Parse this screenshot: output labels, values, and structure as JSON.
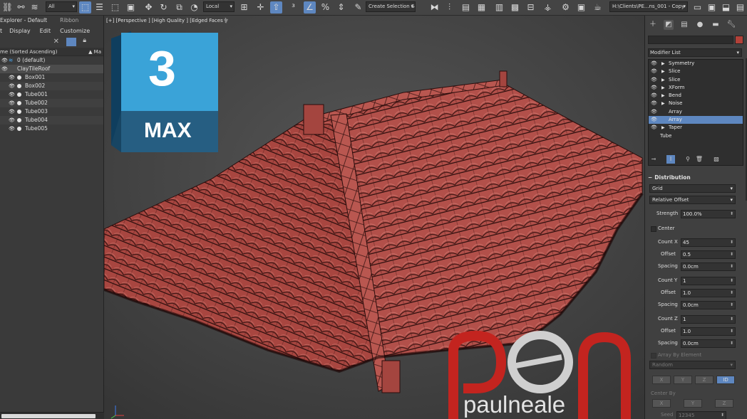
{
  "toolbar": {
    "selection_filter": "All",
    "reference_coord": "Local",
    "named_selection": "Create Selection Se",
    "project_path": "H:\\Clients\\PE...ns_001 - Copy",
    "icons": [
      "link-icon",
      "unlink-icon",
      "bind-spacewarp-icon",
      "select-object-icon",
      "select-by-name-icon",
      "select-region-icon",
      "window-crossing-icon",
      "move-icon",
      "rotate-icon",
      "scale-icon",
      "select-manipulate-icon",
      "pivot-center-icon",
      "select-and-link-icon",
      "snaps-icon",
      "angle-snap-icon",
      "percent-snap-icon",
      "spinner-snap-icon",
      "mirror-icon",
      "align-icon",
      "layer-explorer-icon",
      "ribbon-toggle-icon",
      "curve-editor-icon",
      "schematic-view-icon",
      "material-editor-icon",
      "render-setup-icon",
      "render-frame-icon",
      "render-icon"
    ]
  },
  "scene_explorer": {
    "title": "Explorer - Default",
    "ribbon_tab": "Ribbon",
    "menu": [
      "Display",
      "Edit",
      "Customize"
    ],
    "column_header": "me (Sorted Ascending)",
    "column_header_right": "▲ Ma",
    "rows": [
      {
        "label": "0 (default)",
        "type": "layer",
        "indent": 0
      },
      {
        "label": "ClayTileRoof",
        "type": "object",
        "indent": 1
      },
      {
        "label": "Box001",
        "type": "object",
        "indent": 2
      },
      {
        "label": "Box002",
        "type": "object",
        "indent": 2
      },
      {
        "label": "Tube001",
        "type": "object",
        "indent": 2
      },
      {
        "label": "Tube002",
        "type": "object",
        "indent": 2
      },
      {
        "label": "Tube003",
        "type": "object",
        "indent": 2
      },
      {
        "label": "Tube004",
        "type": "object",
        "indent": 2
      },
      {
        "label": "Tube005",
        "type": "object",
        "indent": 2
      }
    ]
  },
  "viewport": {
    "label": "[+] [Perspective ] [High Quality ] [Edged Faces ]",
    "logo_number": "3",
    "logo_text": "MAX",
    "watermark_text": "paulneale",
    "tile_color": "#b8524c",
    "background_color": "#4a4a4a"
  },
  "command_panel": {
    "modifier_list_label": "Modifier List",
    "object_color": "#b24139",
    "modifier_stack": [
      {
        "name": "Symmetry",
        "expandable": true,
        "selected": false
      },
      {
        "name": "Slice",
        "expandable": true,
        "selected": false
      },
      {
        "name": "Slice",
        "expandable": true,
        "selected": false
      },
      {
        "name": "XForm",
        "expandable": true,
        "selected": false
      },
      {
        "name": "Bend",
        "expandable": true,
        "selected": false
      },
      {
        "name": "Noise",
        "expandable": true,
        "selected": false
      },
      {
        "name": "Array",
        "expandable": false,
        "selected": false
      },
      {
        "name": "Array",
        "expandable": false,
        "selected": true
      },
      {
        "name": "Taper",
        "expandable": true,
        "selected": false
      },
      {
        "name": "Tube",
        "expandable": false,
        "selected": false,
        "base": true
      }
    ],
    "distribution": {
      "title": "Distribution",
      "mode": "Grid",
      "offset_mode": "Relative Offset",
      "strength_label": "Strength",
      "strength": "100.0%",
      "center_label": "Center",
      "count_x_label": "Count X",
      "count_x": "45",
      "offset_label": "Offset",
      "offset_x": "0.5",
      "spacing_label": "Spacing",
      "spacing_x": "0.0cm",
      "count_y_label": "Count Y",
      "count_y": "1",
      "offset_y": "1.0",
      "spacing_y": "0.0cm",
      "count_z_label": "Count Z",
      "count_z": "1",
      "offset_z": "1.0",
      "spacing_z": "0.0cm",
      "array_by_element_label": "Array By Element",
      "random_label": "Random",
      "axis_buttons": [
        "X",
        "Y",
        "Z",
        "ID"
      ],
      "center_by_label": "Center By",
      "center_by_buttons": [
        "X",
        "Y",
        "Z"
      ],
      "seed_label": "Seed",
      "seed": "12345"
    }
  }
}
